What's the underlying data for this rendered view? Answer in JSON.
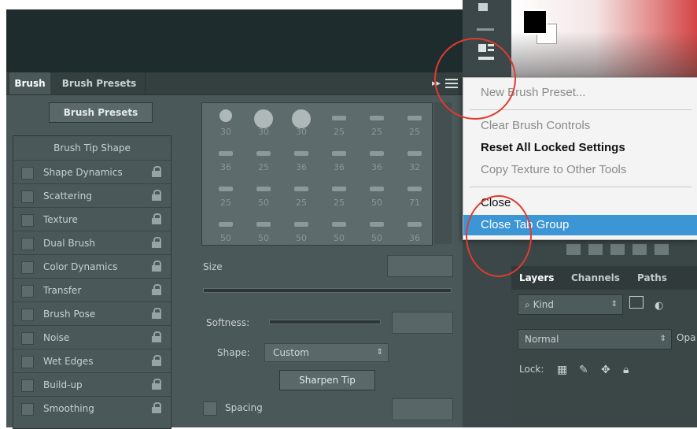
{
  "brush_panel": {
    "tabs": [
      "Brush",
      "Brush Presets"
    ],
    "presets_button": "Brush Presets",
    "collapse_glyph": "▸▸",
    "tip_shape_label": "Brush Tip Shape",
    "options": [
      {
        "label": "Shape Dynamics"
      },
      {
        "label": "Scattering"
      },
      {
        "label": "Texture"
      },
      {
        "label": "Dual Brush"
      },
      {
        "label": "Color Dynamics"
      },
      {
        "label": "Transfer"
      },
      {
        "label": "Brush Pose"
      },
      {
        "label": "Noise"
      },
      {
        "label": "Wet Edges"
      },
      {
        "label": "Build-up"
      },
      {
        "label": "Smoothing"
      }
    ],
    "tip_sizes": [
      "30",
      "30",
      "30",
      "25",
      "25",
      "25",
      "36",
      "25",
      "36",
      "36",
      "36",
      "32",
      "25",
      "50",
      "25",
      "25",
      "50",
      "71",
      "50",
      "50",
      "50",
      "50",
      "50",
      "36"
    ],
    "size_label": "Size",
    "softness_label": "Softness:",
    "shape_label": "Shape:",
    "shape_value": "Custom",
    "sharpen_button": "Sharpen Tip",
    "spacing_label": "Spacing"
  },
  "context_menu": {
    "items": [
      {
        "label": "New Brush Preset...",
        "state": "disabled"
      },
      {
        "label": "Clear Brush Controls",
        "state": "disabled"
      },
      {
        "label": "Reset All Locked Settings",
        "state": "bold"
      },
      {
        "label": "Copy Texture to Other Tools",
        "state": "disabled"
      },
      {
        "label": "Close",
        "state": "enabled"
      },
      {
        "label": "Close Tab Group",
        "state": "highlighted"
      }
    ]
  },
  "layers_panel": {
    "tabs": [
      "Layers",
      "Channels",
      "Paths"
    ],
    "filter_label": "Kind",
    "blend_mode": "Normal",
    "opacity_label": "Opa",
    "lock_label": "Lock:"
  },
  "colors": {
    "highlight": "#3c96d6",
    "annotation_ring": "#e03b2f",
    "panel_bg": "#4b5859"
  }
}
